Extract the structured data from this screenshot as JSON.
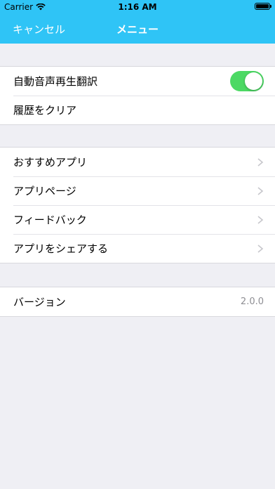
{
  "status_bar": {
    "carrier": "Carrier",
    "time": "1:16 AM"
  },
  "nav": {
    "cancel_label": "キャンセル",
    "title": "メニュー"
  },
  "sections": {
    "settings": {
      "auto_play_label": "自動音声再生翻訳",
      "auto_play_on": true,
      "clear_history_label": "履歴をクリア"
    },
    "apps": {
      "items": [
        "おすすめアプリ",
        "アプリページ",
        "フィードバック",
        "アプリをシェアする"
      ]
    },
    "about": {
      "version_label": "バージョン",
      "version_value": "2.0.0"
    }
  },
  "colors": {
    "nav_bar": "#2fc4f6",
    "background": "#efeff4",
    "switch_on": "#4cd964",
    "secondary_text": "#8e8e93"
  },
  "icons": [
    "wifi-icon",
    "battery-icon",
    "chevron-right-icon"
  ]
}
